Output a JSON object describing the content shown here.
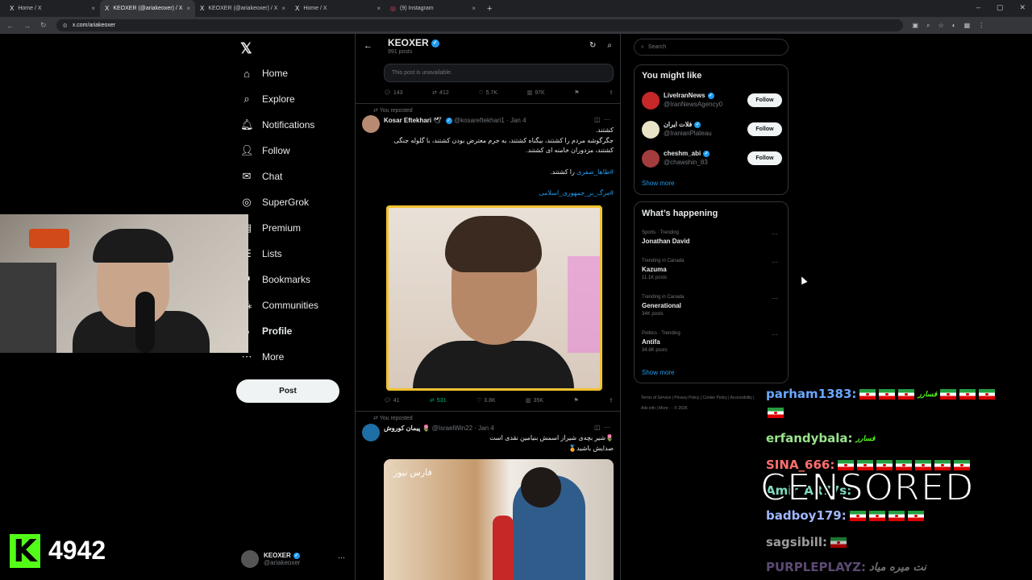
{
  "browser": {
    "tabs": [
      {
        "icon": "X",
        "label": "Home / X",
        "close": "×"
      },
      {
        "icon": "X",
        "label": "KEOXER (@ariakeoxer) / X",
        "close": "×"
      },
      {
        "icon": "X",
        "label": "KEOXER (@ariakeoxer) / X",
        "close": "×"
      },
      {
        "icon": "X",
        "label": "Home / X",
        "close": "×"
      },
      {
        "icon": "◎",
        "label": "(9) Instagram",
        "close": "×"
      }
    ],
    "new_tab": "+",
    "controls": {
      "minimize": "–",
      "maximize": "▢",
      "close": "✕"
    },
    "nav": {
      "back": "←",
      "forward": "→",
      "reload": "↻"
    },
    "url": "x.com/ariakeoxer",
    "site_icon": "⚙",
    "addr_icons": [
      "▣",
      "⌕",
      "☆",
      "◐",
      "▦",
      "⋮"
    ]
  },
  "sidebar": {
    "logo": "𝕏",
    "items": [
      {
        "icon": "⌂",
        "label": "Home"
      },
      {
        "icon": "⌕",
        "label": "Explore"
      },
      {
        "icon": "🔔︎",
        "label": "Notifications"
      },
      {
        "icon": "👤︎",
        "label": "Follow"
      },
      {
        "icon": "✉",
        "label": "Chat"
      },
      {
        "icon": "◎",
        "label": "SuperGrok"
      },
      {
        "icon": "▤",
        "label": "Premium"
      },
      {
        "icon": "☰",
        "label": "Lists"
      },
      {
        "icon": "⚑",
        "label": "Bookmarks"
      },
      {
        "icon": "⁂",
        "label": "Communities"
      },
      {
        "icon": "●",
        "label": "Profile"
      },
      {
        "icon": "⋯",
        "label": "More"
      }
    ],
    "post_label": "Post",
    "account": {
      "name": "KEOXER",
      "handle": "@ariakeoxer",
      "more": "⋯"
    }
  },
  "stream": {
    "kick_logo": "K",
    "count": "4942"
  },
  "timeline": {
    "header": {
      "title": "KEOXER",
      "subtitle": "991 posts",
      "back": "←",
      "refresh": "↻",
      "search": "⌕"
    },
    "unavailable": "This post is unavailable.",
    "top_actions": {
      "replies": "143",
      "reposts": "412",
      "likes": "5.7K",
      "views": "97K"
    },
    "posts": [
      {
        "reposted": "You reposted",
        "name": "Kosar Eftekhari",
        "emoji": "🕊",
        "handle": "@kosareftekhari1",
        "date": "Jan 4",
        "lines": [
          "کشتند.",
          "جگرگوشه مردم را کشتند، بیگناه کشتند، به جرم معترض بودن کشتند، با گلوله جنگی",
          "کشتند، مزدوران خامنه ای کشتند."
        ],
        "hashtag1": "#طاها_صفری",
        "hashtag1_suffix": " را کشتند.",
        "hashtag2": "#مرگ_بر_جمهوری_اسلامی",
        "actions": {
          "replies": "41",
          "reposts": "531",
          "likes": "3.8K",
          "views": "35K"
        }
      },
      {
        "reposted": "You reposted",
        "name": "پیمان کوروش",
        "emoji": "🌷",
        "handle": "@IsraelWin22",
        "date": "Jan 4",
        "lines": [
          "🌷شیر بچه‌ی شیراز اسمش بنیامین نقدی است",
          "صدایش باشید🏅"
        ],
        "watermark": "فارس نیوز"
      }
    ]
  },
  "right": {
    "search_placeholder": "Search",
    "wtf_title": "You might like",
    "wtf": [
      {
        "name": "LiveIranNews",
        "handle": "@IranNewsAgency0",
        "follow": "Follow"
      },
      {
        "name": "فلات ایران",
        "handle": "@IranianPlateau",
        "follow": "Follow"
      },
      {
        "name": "cheshm_abi",
        "handle": "@chawshin_83",
        "follow": "Follow"
      }
    ],
    "show_more": "Show more",
    "happening_title": "What’s happening",
    "trends": [
      {
        "meta": "Sports · Trending",
        "title": "Jonathan David",
        "count": ""
      },
      {
        "meta": "Trending in Canada",
        "title": "Kazuma",
        "count": "11.1K posts"
      },
      {
        "meta": "Trending in Canada",
        "title": "Generational",
        "count": "34K posts"
      },
      {
        "meta": "Politics · Trending",
        "title": "Antifa",
        "count": "34.8K posts"
      }
    ],
    "show_more2": "Show more",
    "footer": "Terms of Service  |  Privacy Policy  |  Cookie Policy  |  Accessibility  |  Ads info  |  More ···  © 2026"
  },
  "chat": {
    "messages": [
      {
        "user": "parham1383:",
        "flags": 6,
        "emote": "فسارر"
      },
      {
        "user": "erfandybala:",
        "flags": 0,
        "emote": "فسارر"
      },
      {
        "user": "SINA_666:",
        "flags": 7,
        "emote": ""
      },
      {
        "user": "Amir_AR77s:",
        "flags": 0,
        "emote": ""
      },
      {
        "user": "badboy179:",
        "flags": 4,
        "emote": ""
      },
      {
        "user": "sagsibill:",
        "flags": 1,
        "emote": ""
      },
      {
        "user": "PURPLEPLAYZ:",
        "flags": 0,
        "emote": "نت میره میاد"
      }
    ],
    "censored": "CENSORED"
  }
}
